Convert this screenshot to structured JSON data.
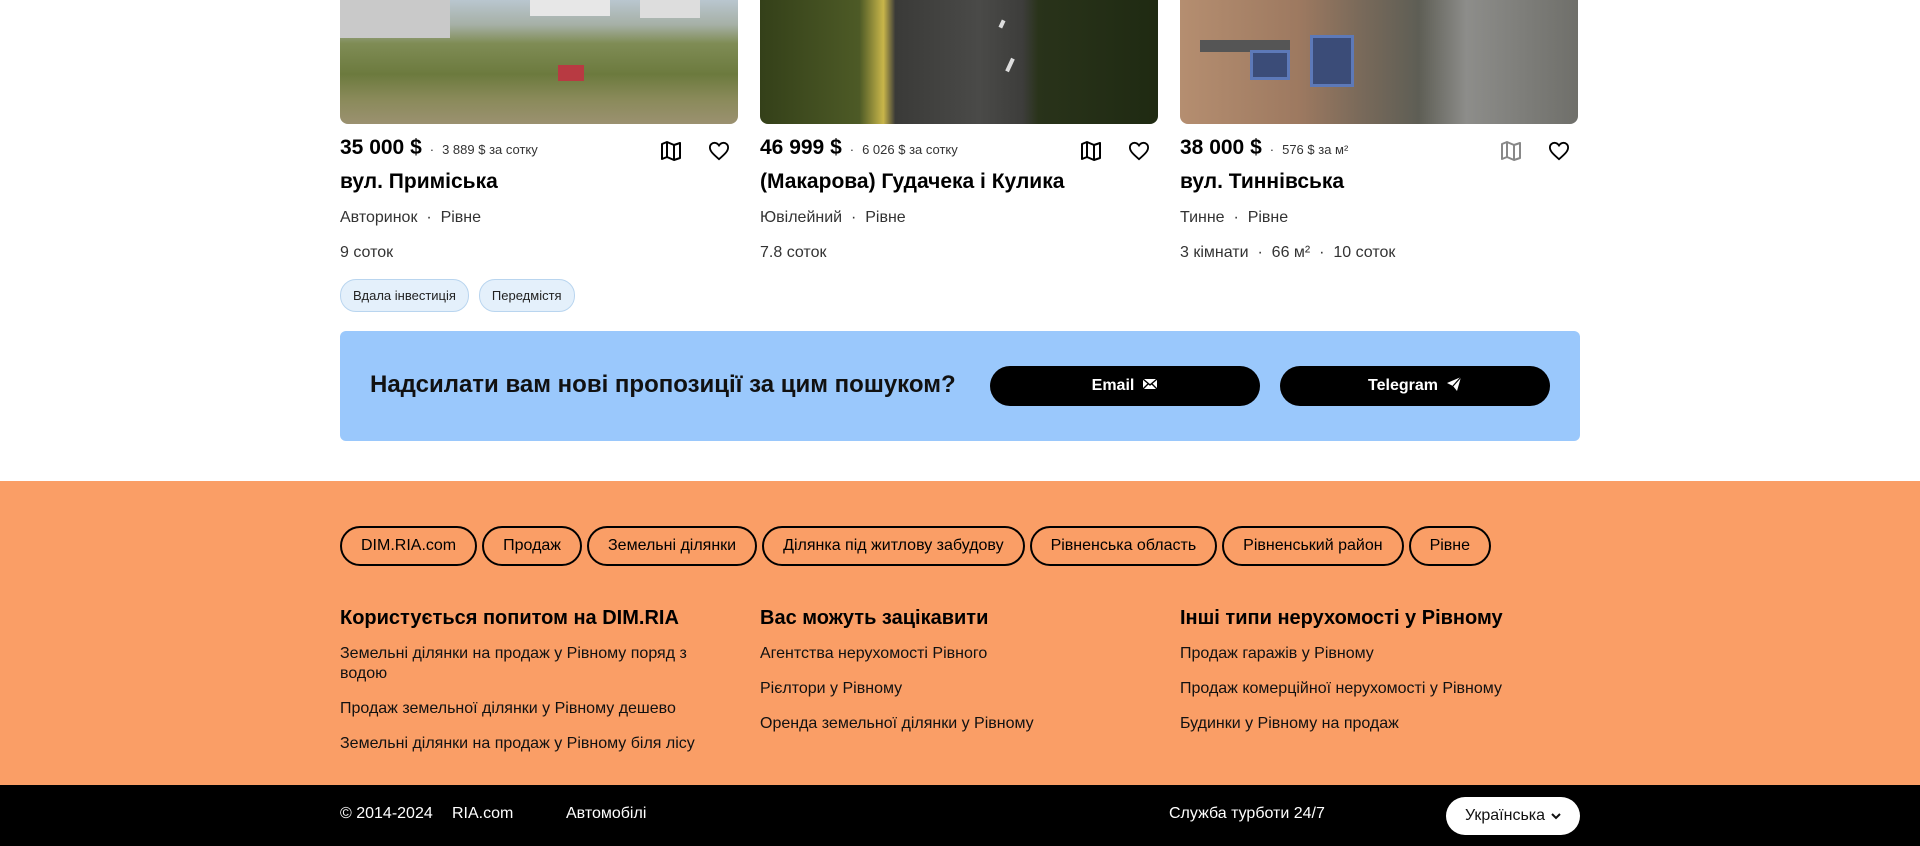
{
  "cards": [
    {
      "price": "35 000 $",
      "unit_price": "3 889 $ за сотку",
      "address": "вул. Приміська",
      "district": "Авторинок",
      "city": "Рівне",
      "meta": [
        "9 соток"
      ],
      "tags": [
        "Вдала інвестиція",
        "Передмістя"
      ]
    },
    {
      "price": "46 999 $",
      "unit_price": "6 026 $ за сотку",
      "address": "(Макарова) Гудачека і Кулика",
      "district": "Ювілейний",
      "city": "Рівне",
      "meta": [
        "7.8 соток"
      ],
      "tags": []
    },
    {
      "price": "38 000 $",
      "unit_price": "576 $ за м²",
      "address": "вул. Тиннівська",
      "district": "Тинне",
      "city": "Рівне",
      "meta": [
        "3 кімнати",
        "66 м²",
        "10 соток"
      ],
      "tags": []
    }
  ],
  "subscribe": {
    "question": "Надсилати вам нові пропозиції за цим пошуком?",
    "email_label": "Email",
    "telegram_label": "Telegram"
  },
  "breadcrumbs": [
    "DIM.RIA.com",
    "Продаж",
    "Земельні ділянки",
    "Ділянка під житлову забудову",
    "Рівненська область",
    "Рівненський район",
    "Рівне"
  ],
  "footer_columns": [
    {
      "title": "Користується попитом на DIM.RIA",
      "links": [
        "Земельні ділянки на продаж у Рівному поряд з водою",
        "Продаж земельної ділянки у Рівному дешево",
        "Земельні ділянки на продаж у Рівному біля лісу"
      ]
    },
    {
      "title": "Вас можуть зацікавити",
      "links": [
        "Агентства нерухомості Рівного",
        "Рієлтори у Рівному",
        "Оренда земельної ділянки у Рівному"
      ]
    },
    {
      "title": "Інші типи нерухомості у Рівному",
      "links": [
        "Продаж гаражів у Рівному",
        "Продаж комерційної нерухомості у Рівному",
        "Будинки у Рівному на продаж"
      ]
    }
  ],
  "bottom_bar": {
    "copyright": "© 2014-2024",
    "ria_link": "RIA.com",
    "auto_link": "Автомобілі",
    "support": "Служба турботи 24/7",
    "language": "Українська"
  },
  "colors": {
    "subscribe_bg": "#9ac8fc",
    "footer_bg": "#fa9e66",
    "bottom_bg": "#000000",
    "tag_bg": "#e4f0fb"
  },
  "icons": {
    "map": "map-icon",
    "favorite": "heart-icon",
    "email": "envelope-icon",
    "telegram": "paper-plane-icon",
    "language": "chevron-down-icon"
  }
}
